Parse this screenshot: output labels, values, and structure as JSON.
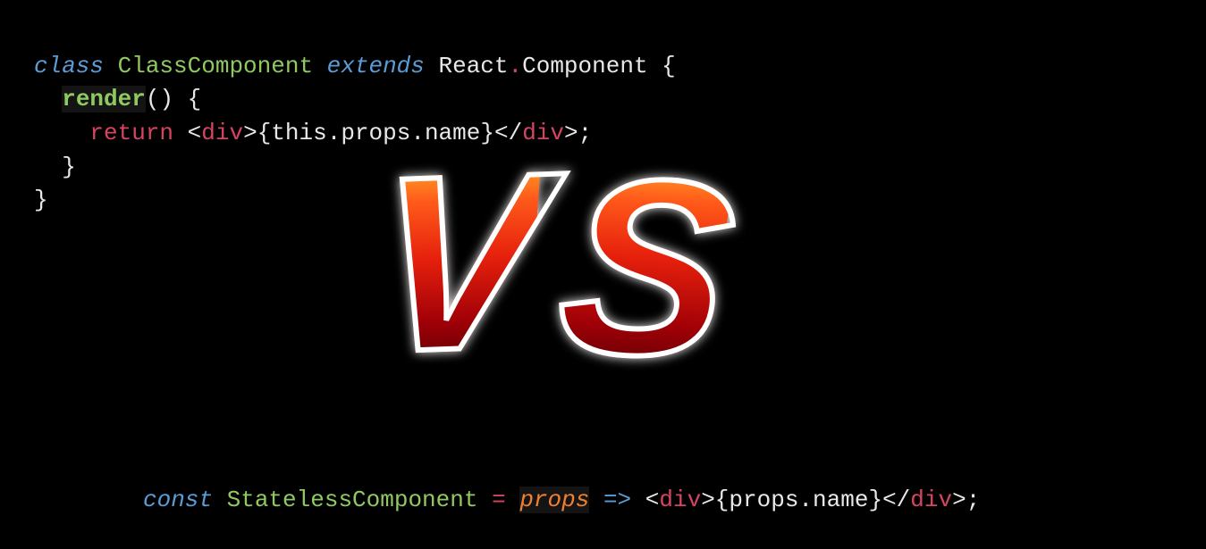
{
  "code_top": {
    "line1": {
      "class_kw": "class",
      "sp1": " ",
      "name": "ClassComponent",
      "sp2": " ",
      "extends_kw": "extends",
      "sp3": " ",
      "react": "React",
      "dot": ".",
      "component": "Component",
      "sp4": " ",
      "brace_open": "{"
    },
    "line2": {
      "indent": "  ",
      "render": "render",
      "parens": "()",
      "sp": " ",
      "brace_open": "{"
    },
    "line3": {
      "indent": "    ",
      "return_kw": "return",
      "sp": " ",
      "lt1": "<",
      "tag1": "div",
      "gt1": ">",
      "brace_l": "{",
      "this": "this",
      "dot1": ".",
      "props": "props",
      "dot2": ".",
      "name": "name",
      "brace_r": "}",
      "lt2": "</",
      "tag2": "div",
      "gt2": ">",
      "semi": ";"
    },
    "line4": {
      "indent": "  ",
      "brace_close": "}"
    },
    "line5": {
      "brace_close": "}"
    }
  },
  "code_bottom": {
    "const_kw": "const",
    "sp1": " ",
    "name": "StatelessComponent",
    "sp2": " ",
    "equals": "=",
    "sp3": " ",
    "param": "props",
    "sp4": " ",
    "arrow": "=>",
    "sp5": " ",
    "lt1": "<",
    "tag1": "div",
    "gt1": ">",
    "brace_l": "{",
    "props": "props",
    "dot": ".",
    "prop_name": "name",
    "brace_r": "}",
    "lt2": "</",
    "tag2": "div",
    "gt2": ">",
    "semi": ";"
  },
  "vs": {
    "v": "V",
    "s": "S"
  }
}
